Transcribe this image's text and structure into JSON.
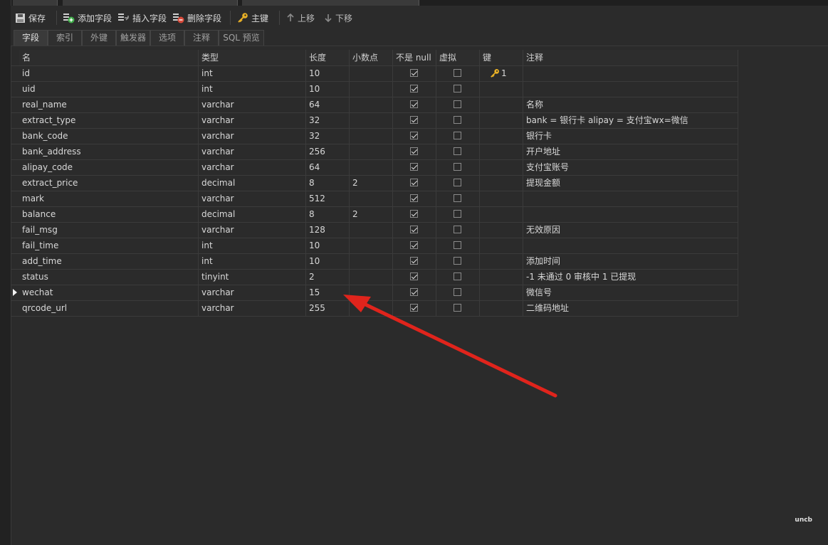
{
  "toolbar": {
    "save": "保存",
    "add_field": "添加字段",
    "insert_field": "插入字段",
    "delete_field": "删除字段",
    "primary_key": "主键",
    "move_up": "上移",
    "move_down": "下移"
  },
  "tabs": [
    "字段",
    "索引",
    "外键",
    "触发器",
    "选项",
    "注释",
    "SQL 预览"
  ],
  "columns": [
    "名",
    "类型",
    "长度",
    "小数点",
    "不是 null",
    "虚拟",
    "键",
    "注释"
  ],
  "rows": [
    {
      "name": "id",
      "type": "int",
      "length": "10",
      "decimals": "",
      "not_null": true,
      "virtual": false,
      "key": "1",
      "comment": ""
    },
    {
      "name": "uid",
      "type": "int",
      "length": "10",
      "decimals": "",
      "not_null": true,
      "virtual": false,
      "key": "",
      "comment": ""
    },
    {
      "name": "real_name",
      "type": "varchar",
      "length": "64",
      "decimals": "",
      "not_null": true,
      "virtual": false,
      "key": "",
      "comment": "名称"
    },
    {
      "name": "extract_type",
      "type": "varchar",
      "length": "32",
      "decimals": "",
      "not_null": true,
      "virtual": false,
      "key": "",
      "comment": "bank = 银行卡 alipay = 支付宝wx=微信"
    },
    {
      "name": "bank_code",
      "type": "varchar",
      "length": "32",
      "decimals": "",
      "not_null": true,
      "virtual": false,
      "key": "",
      "comment": "银行卡"
    },
    {
      "name": "bank_address",
      "type": "varchar",
      "length": "256",
      "decimals": "",
      "not_null": true,
      "virtual": false,
      "key": "",
      "comment": "开户地址"
    },
    {
      "name": "alipay_code",
      "type": "varchar",
      "length": "64",
      "decimals": "",
      "not_null": true,
      "virtual": false,
      "key": "",
      "comment": "支付宝账号"
    },
    {
      "name": "extract_price",
      "type": "decimal",
      "length": "8",
      "decimals": "2",
      "not_null": true,
      "virtual": false,
      "key": "",
      "comment": "提现金额"
    },
    {
      "name": "mark",
      "type": "varchar",
      "length": "512",
      "decimals": "",
      "not_null": true,
      "virtual": false,
      "key": "",
      "comment": ""
    },
    {
      "name": "balance",
      "type": "decimal",
      "length": "8",
      "decimals": "2",
      "not_null": true,
      "virtual": false,
      "key": "",
      "comment": ""
    },
    {
      "name": "fail_msg",
      "type": "varchar",
      "length": "128",
      "decimals": "",
      "not_null": true,
      "virtual": false,
      "key": "",
      "comment": "无效原因"
    },
    {
      "name": "fail_time",
      "type": "int",
      "length": "10",
      "decimals": "",
      "not_null": true,
      "virtual": false,
      "key": "",
      "comment": ""
    },
    {
      "name": "add_time",
      "type": "int",
      "length": "10",
      "decimals": "",
      "not_null": true,
      "virtual": false,
      "key": "",
      "comment": "添加时间"
    },
    {
      "name": "status",
      "type": "tinyint",
      "length": "2",
      "decimals": "",
      "not_null": true,
      "virtual": false,
      "key": "",
      "comment": "-1 未通过 0 审核中 1 已提现"
    },
    {
      "name": "wechat",
      "type": "varchar",
      "length": "15",
      "decimals": "",
      "not_null": true,
      "virtual": false,
      "key": "",
      "comment": "微信号",
      "current": true
    },
    {
      "name": "qrcode_url",
      "type": "varchar",
      "length": "255",
      "decimals": "",
      "not_null": true,
      "virtual": false,
      "key": "",
      "comment": "二维码地址"
    }
  ],
  "colors": {
    "background": "#2b2b2b",
    "annotation_arrow": "#e0241c",
    "key_icon": "#e8b026",
    "add_icon": "#3fae49",
    "delete_icon": "#d84a3a"
  },
  "watermark": "uncb"
}
